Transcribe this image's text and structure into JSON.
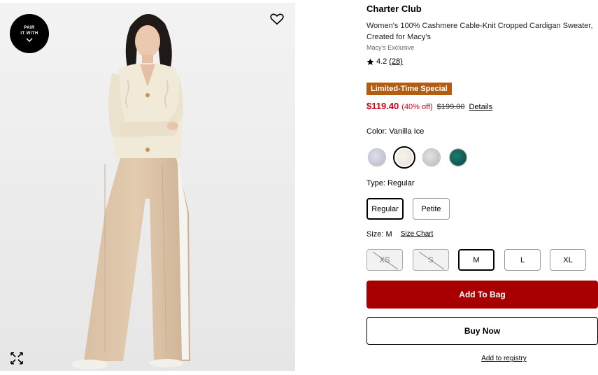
{
  "image_panel": {
    "pair_badge": {
      "line1": "PAIR",
      "line2": "IT WITH",
      "icon": "chevron-down-icon"
    },
    "favorite_icon": "heart-outline-icon",
    "expand_icon": "expand-arrows-icon"
  },
  "product": {
    "brand": "Charter Club",
    "title": "Women's 100% Cashmere Cable-Knit Cropped Cardigan Sweater, Created for Macy's",
    "exclusive_label": "Macy's Exclusive",
    "rating": {
      "value": "4.2",
      "count": "(28)",
      "star_icon": "star-icon"
    },
    "promo_badge": "Limited-Time Special",
    "promo_color": "#b55c0e",
    "price": {
      "current": "$119.40",
      "discount": "(40% off)",
      "original": "$199.00",
      "details_link": "Details",
      "sale_color": "#d0021b"
    },
    "color": {
      "label": "Color:",
      "selected": "Vanilla Ice",
      "swatches": [
        {
          "name": "light-lavender",
          "hex": "#c9cad8",
          "selected": false
        },
        {
          "name": "Vanilla Ice",
          "hex": "#f1ede4",
          "selected": true
        },
        {
          "name": "light-grey",
          "hex": "#cfcfd1",
          "selected": false
        },
        {
          "name": "dark-teal",
          "hex": "#0f5a52",
          "selected": false
        }
      ]
    },
    "type": {
      "label": "Type:",
      "selected": "Regular",
      "options": [
        {
          "label": "Regular",
          "selected": true
        },
        {
          "label": "Petite",
          "selected": false
        }
      ]
    },
    "size": {
      "label": "Size:",
      "selected": "M",
      "size_chart_link": "Size Chart",
      "options": [
        {
          "label": "XS",
          "available": false,
          "selected": false
        },
        {
          "label": "S",
          "available": false,
          "selected": false
        },
        {
          "label": "M",
          "available": true,
          "selected": true
        },
        {
          "label": "L",
          "available": true,
          "selected": false
        },
        {
          "label": "XL",
          "available": true,
          "selected": false
        }
      ]
    },
    "actions": {
      "add_to_bag": "Add To Bag",
      "buy_now": "Buy Now",
      "add_to_registry": "Add to registry",
      "primary_color": "#a80000"
    }
  }
}
